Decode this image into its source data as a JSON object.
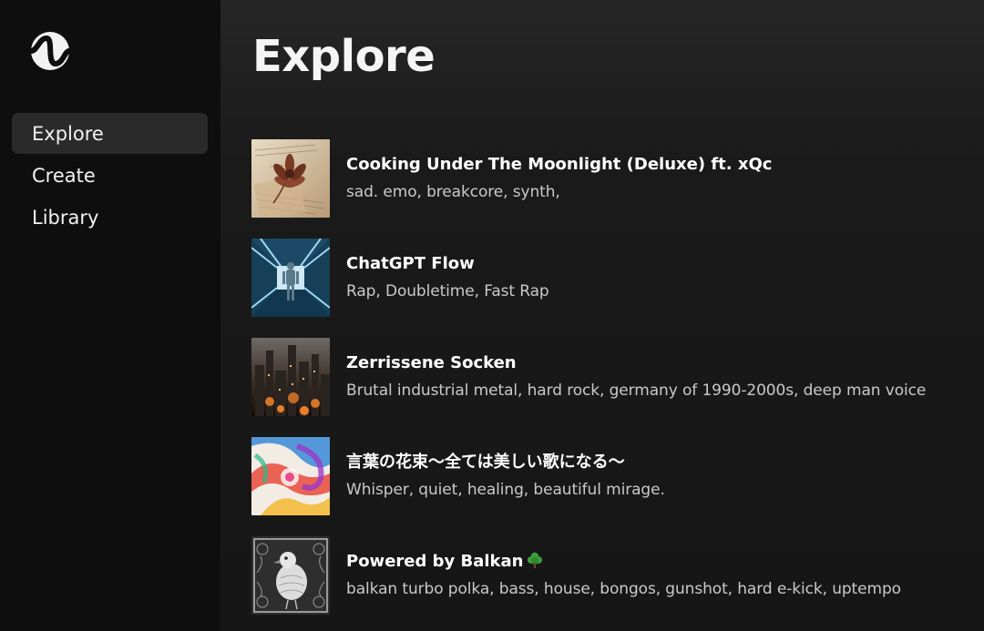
{
  "sidebar": {
    "logo_icon": "wave-logo-icon",
    "items": [
      {
        "label": "Explore",
        "active": true
      },
      {
        "label": "Create",
        "active": false
      },
      {
        "label": "Library",
        "active": false
      }
    ]
  },
  "main": {
    "title": "Explore",
    "songs": [
      {
        "title": "Cooking Under The Moonlight (Deluxe) ft. xQc",
        "tags": "sad. emo, breakcore, synth,",
        "cover": "dried-flower-paper-cover"
      },
      {
        "title": "ChatGPT Flow",
        "tags": "Rap, Doubletime, Fast Rap",
        "cover": "robot-tunnel-cover"
      },
      {
        "title": "Zerrissene Socken",
        "tags": "Brutal industrial metal, hard rock, germany of 1990-2000s, deep man voice",
        "cover": "burning-city-cover"
      },
      {
        "title": "言葉の花束～全ては美しい歌になる～",
        "tags": "Whisper, quiet, healing, beautiful mirage.",
        "cover": "colorful-swirl-cover"
      },
      {
        "title": "Powered by Balkan",
        "tags": "balkan turbo polka, bass, house, bongos, gunshot, hard e-kick, uptempo",
        "cover": "ornate-bird-cover",
        "title_icon": "tree-icon"
      }
    ]
  },
  "colors": {
    "sidebar_bg": "#0e0e0e",
    "active_item_bg": "#2a2a2a",
    "main_bg": "#1a1a1a",
    "tag_text": "#c9c9c9",
    "tree_green": "#3aa03a"
  }
}
